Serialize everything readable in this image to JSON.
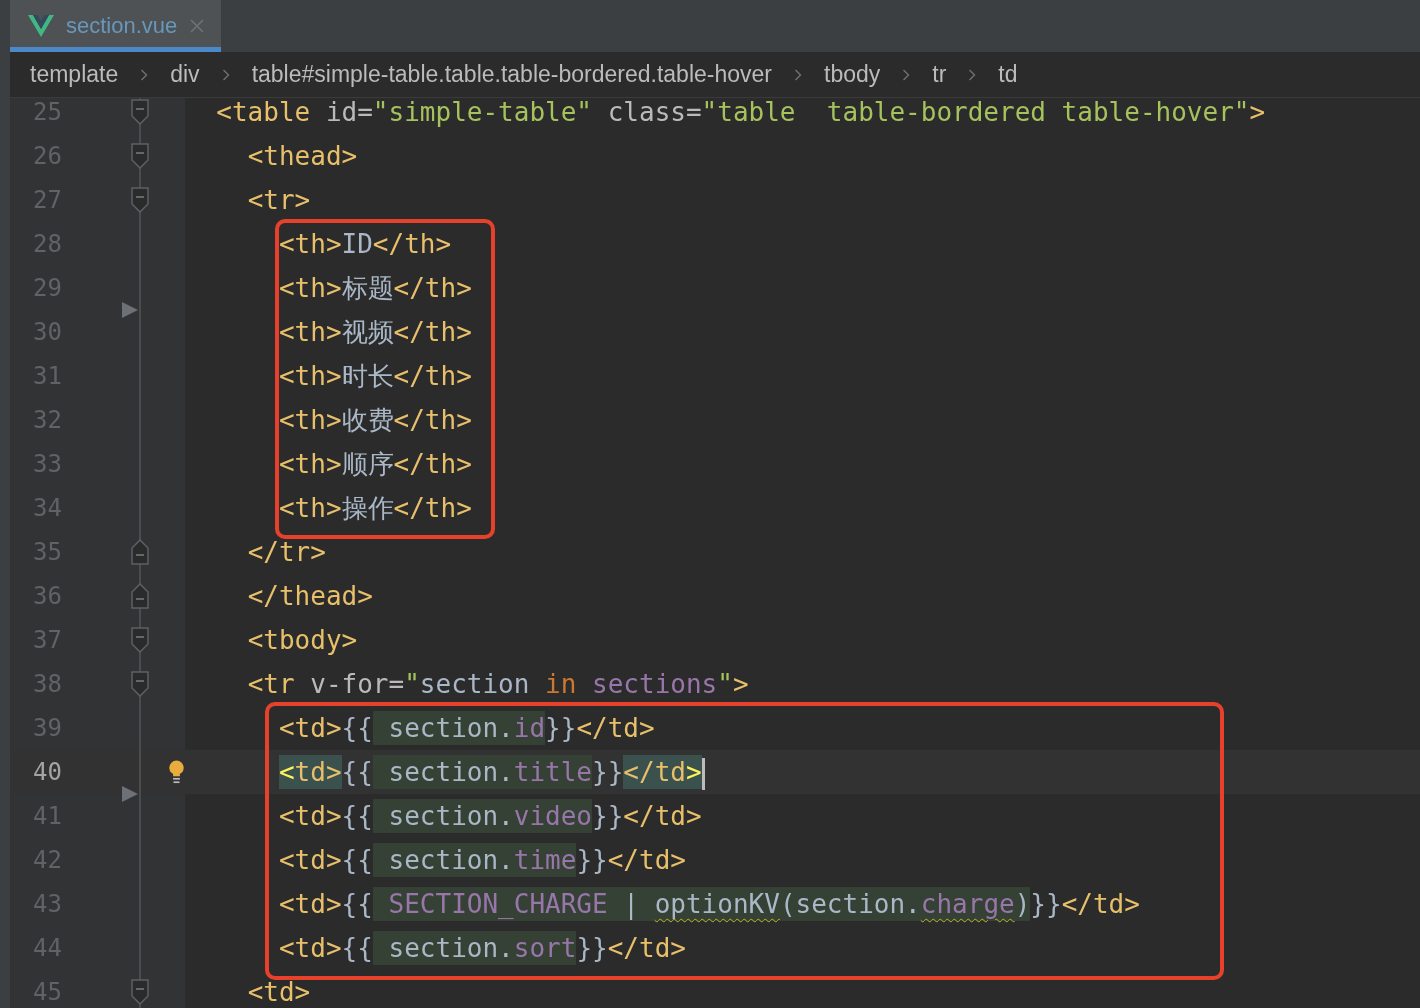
{
  "tabs": [
    {
      "label": "section.vue",
      "selected": true
    }
  ],
  "breadcrumbs": [
    "template",
    "div",
    "table#simple-table.table.table-bordered.table-hover",
    "tbody",
    "tr",
    "td"
  ],
  "lines": [
    {
      "number": "25",
      "kind": "fold_start",
      "current": false,
      "tokens": [
        {
          "text": "  <table ",
          "kind": "tag"
        },
        {
          "text": "id=",
          "kind": "attr"
        },
        {
          "text": "\"simple-table\"",
          "kind": "string"
        },
        {
          "text": " class=",
          "kind": "attr"
        },
        {
          "text": "\"table  table-bordered table-hover\"",
          "kind": "string"
        },
        {
          "text": ">",
          "kind": "tag"
        }
      ]
    },
    {
      "number": "26",
      "kind": "fold_start",
      "current": false,
      "tokens": [
        {
          "text": "    <thead>",
          "kind": "tag"
        }
      ]
    },
    {
      "number": "27",
      "kind": "fold_start",
      "current": false,
      "tokens": [
        {
          "text": "    <tr>",
          "kind": "tag"
        }
      ]
    },
    {
      "number": "28",
      "kind": "plain",
      "current": false,
      "tokens": [
        {
          "text": "      <th>",
          "kind": "tag"
        },
        {
          "text": "ID",
          "kind": "text"
        },
        {
          "text": "</th>",
          "kind": "tag"
        }
      ]
    },
    {
      "number": "29",
      "kind": "plain",
      "current": false,
      "marker": true,
      "tokens": [
        {
          "text": "      <th>",
          "kind": "tag"
        },
        {
          "text": "标题",
          "kind": "text"
        },
        {
          "text": "</th>",
          "kind": "tag"
        }
      ]
    },
    {
      "number": "30",
      "kind": "plain",
      "current": false,
      "tokens": [
        {
          "text": "      <th>",
          "kind": "tag"
        },
        {
          "text": "视频",
          "kind": "text"
        },
        {
          "text": "</th>",
          "kind": "tag"
        }
      ]
    },
    {
      "number": "31",
      "kind": "plain",
      "current": false,
      "tokens": [
        {
          "text": "      <th>",
          "kind": "tag"
        },
        {
          "text": "时长",
          "kind": "text"
        },
        {
          "text": "</th>",
          "kind": "tag"
        }
      ]
    },
    {
      "number": "32",
      "kind": "plain",
      "current": false,
      "tokens": [
        {
          "text": "      <th>",
          "kind": "tag"
        },
        {
          "text": "收费",
          "kind": "text"
        },
        {
          "text": "</th>",
          "kind": "tag"
        }
      ]
    },
    {
      "number": "33",
      "kind": "plain",
      "current": false,
      "tokens": [
        {
          "text": "      <th>",
          "kind": "tag"
        },
        {
          "text": "顺序",
          "kind": "text"
        },
        {
          "text": "</th>",
          "kind": "tag"
        }
      ]
    },
    {
      "number": "34",
      "kind": "plain",
      "current": false,
      "tokens": [
        {
          "text": "      <th>",
          "kind": "tag"
        },
        {
          "text": "操作",
          "kind": "text"
        },
        {
          "text": "</th>",
          "kind": "tag"
        }
      ]
    },
    {
      "number": "35",
      "kind": "fold_end",
      "current": false,
      "tokens": [
        {
          "text": "    </tr>",
          "kind": "tag"
        }
      ]
    },
    {
      "number": "36",
      "kind": "fold_end",
      "current": false,
      "tokens": [
        {
          "text": "    </thead>",
          "kind": "tag"
        }
      ]
    },
    {
      "number": "37",
      "kind": "fold_start",
      "current": false,
      "tokens": [
        {
          "text": "    <tbody>",
          "kind": "tag"
        }
      ]
    },
    {
      "number": "38",
      "kind": "fold_start",
      "current": false,
      "tokens": [
        {
          "text": "    <tr",
          "kind": "tag"
        },
        {
          "text": " v-for=",
          "kind": "attr"
        },
        {
          "text": "\"",
          "kind": "string"
        },
        {
          "text": "section",
          "kind": "text"
        },
        {
          "text": " in ",
          "kind": "keyword"
        },
        {
          "text": "sections",
          "kind": "prop"
        },
        {
          "text": "\"",
          "kind": "string"
        },
        {
          "text": ">",
          "kind": "tag"
        }
      ]
    },
    {
      "number": "39",
      "kind": "plain",
      "current": false,
      "tokens": [
        {
          "text": "      <td>",
          "kind": "tag"
        },
        {
          "text": "{{",
          "kind": "text"
        },
        {
          "text": " section.",
          "kind": "text",
          "injected": true
        },
        {
          "text": "id",
          "kind": "prop",
          "injected": true
        },
        {
          "text": "}}",
          "kind": "text"
        },
        {
          "text": "</td>",
          "kind": "tag"
        }
      ]
    },
    {
      "number": "40",
      "kind": "plain",
      "current": true,
      "marker": true,
      "intention": true,
      "caret": true,
      "tokens": [
        {
          "text": "      <",
          "kind": "tag_hi",
          "matched": true
        },
        {
          "text": "td>",
          "kind": "tag",
          "matched": true
        },
        {
          "text": "{{",
          "kind": "text"
        },
        {
          "text": " section.",
          "kind": "text",
          "injected": true
        },
        {
          "text": "title",
          "kind": "prop",
          "injected": true
        },
        {
          "text": "}}",
          "kind": "text"
        },
        {
          "text": "</td",
          "kind": "tag",
          "matched": true
        },
        {
          "text": ">",
          "kind": "tag_hi",
          "matched": true
        }
      ]
    },
    {
      "number": "41",
      "kind": "plain",
      "current": false,
      "tokens": [
        {
          "text": "      <td>",
          "kind": "tag"
        },
        {
          "text": "{{",
          "kind": "text"
        },
        {
          "text": " section.",
          "kind": "text",
          "injected": true
        },
        {
          "text": "video",
          "kind": "prop",
          "injected": true
        },
        {
          "text": "}}",
          "kind": "text"
        },
        {
          "text": "</td>",
          "kind": "tag"
        }
      ]
    },
    {
      "number": "42",
      "kind": "plain",
      "current": false,
      "tokens": [
        {
          "text": "      <td>",
          "kind": "tag"
        },
        {
          "text": "{{",
          "kind": "text"
        },
        {
          "text": " section.",
          "kind": "text",
          "injected": true
        },
        {
          "text": "time",
          "kind": "prop",
          "injected": true
        },
        {
          "text": "}}",
          "kind": "text"
        },
        {
          "text": "</td>",
          "kind": "tag"
        }
      ]
    },
    {
      "number": "43",
      "kind": "plain",
      "current": false,
      "tokens": [
        {
          "text": "      <td>",
          "kind": "tag"
        },
        {
          "text": "{{",
          "kind": "text"
        },
        {
          "text": " SECTION_CHARGE",
          "kind": "prop",
          "injected": true
        },
        {
          "text": " | ",
          "kind": "text",
          "injected": true
        },
        {
          "text": "optionKV",
          "kind": "text",
          "injected": true,
          "warning": true
        },
        {
          "text": "(section.",
          "kind": "text",
          "injected": true
        },
        {
          "text": "charge",
          "kind": "prop",
          "injected": true,
          "warning": true
        },
        {
          "text": ")",
          "kind": "text",
          "injected": true
        },
        {
          "text": "}}",
          "kind": "text"
        },
        {
          "text": "</td>",
          "kind": "tag"
        }
      ]
    },
    {
      "number": "44",
      "kind": "plain",
      "current": false,
      "tokens": [
        {
          "text": "      <td>",
          "kind": "tag"
        },
        {
          "text": "{{",
          "kind": "text"
        },
        {
          "text": " section.",
          "kind": "text",
          "injected": true
        },
        {
          "text": "sort",
          "kind": "prop",
          "injected": true
        },
        {
          "text": "}}",
          "kind": "text"
        },
        {
          "text": "</td>",
          "kind": "tag"
        }
      ]
    },
    {
      "number": "45",
      "kind": "fold_start",
      "current": false,
      "tokens": [
        {
          "text": "    <td>",
          "kind": "tag"
        }
      ]
    }
  ]
}
